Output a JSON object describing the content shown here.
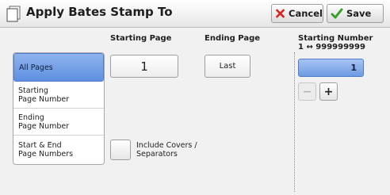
{
  "header": {
    "title": "Apply Bates Stamp To",
    "cancel_label": "Cancel",
    "save_label": "Save"
  },
  "columns": {
    "starting_page_label": "Starting Page",
    "ending_page_label": "Ending Page",
    "starting_number_label": "Starting Number",
    "starting_number_range": "1 ↔ 999999999"
  },
  "options": [
    {
      "line1": "All Pages",
      "line2": "",
      "selected": true
    },
    {
      "line1": "Starting",
      "line2": "Page Number",
      "selected": false
    },
    {
      "line1": "Ending",
      "line2": "Page Number",
      "selected": false
    },
    {
      "line1": "Start & End",
      "line2": "Page Numbers",
      "selected": false
    }
  ],
  "starting_page_value": "1",
  "ending_page_value": "Last",
  "starting_number_value": "1",
  "stepper": {
    "minus": "−",
    "plus": "+"
  },
  "include_covers": {
    "line1": "Include Covers /",
    "line2": "Separators",
    "checked": false
  },
  "colors": {
    "accent": "#6f9be3",
    "header_bg": "#f2f2f2"
  }
}
